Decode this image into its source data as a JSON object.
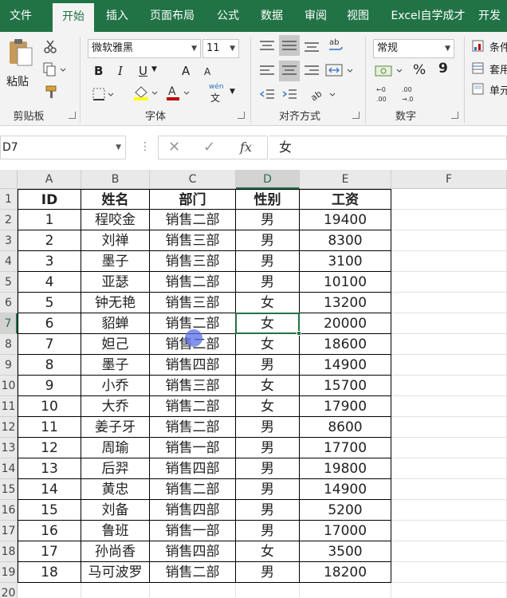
{
  "tabs": [
    "文件",
    "开始",
    "插入",
    "页面布局",
    "公式",
    "数据",
    "审阅",
    "视图",
    "Excel自学成才",
    "开发"
  ],
  "active_tab": 1,
  "ribbon": {
    "clipboard": {
      "label": "剪贴板",
      "paste": "粘贴"
    },
    "font": {
      "label": "字体",
      "name": "微软雅黑",
      "size": "11",
      "bold": "B",
      "italic": "I",
      "underline": "U",
      "grow": "A",
      "shrink": "A",
      "phonetic_top": "wén",
      "phonetic_bottom": "文"
    },
    "alignment": {
      "label": "对齐方式"
    },
    "number": {
      "label": "数字",
      "format": "常规",
      "percent": "%",
      "comma": "9"
    },
    "styles": {
      "item1": "条件",
      "item2": "套用",
      "item3": "单元"
    }
  },
  "formula_bar": {
    "name_box": "D7",
    "fx": "fx",
    "value": "女"
  },
  "columns": [
    "A",
    "B",
    "C",
    "D",
    "E",
    "F"
  ],
  "selected_column": "D",
  "selected_row": 7,
  "rows": [
    "1",
    "2",
    "3",
    "4",
    "5",
    "6",
    "7",
    "8",
    "9",
    "10",
    "11",
    "12",
    "13",
    "14",
    "15",
    "16",
    "17",
    "18",
    "19",
    "20"
  ],
  "table": {
    "headers": [
      "ID",
      "姓名",
      "部门",
      "性别",
      "工资"
    ],
    "rows": [
      [
        "1",
        "程咬金",
        "销售二部",
        "男",
        "19400"
      ],
      [
        "2",
        "刘禅",
        "销售三部",
        "男",
        "8300"
      ],
      [
        "3",
        "墨子",
        "销售三部",
        "男",
        "3100"
      ],
      [
        "4",
        "亚瑟",
        "销售二部",
        "男",
        "10100"
      ],
      [
        "5",
        "钟无艳",
        "销售三部",
        "女",
        "13200"
      ],
      [
        "6",
        "貂蝉",
        "销售二部",
        "女",
        "20000"
      ],
      [
        "7",
        "妲己",
        "销售二部",
        "女",
        "18600"
      ],
      [
        "8",
        "墨子",
        "销售四部",
        "男",
        "14900"
      ],
      [
        "9",
        "小乔",
        "销售三部",
        "女",
        "15700"
      ],
      [
        "10",
        "大乔",
        "销售二部",
        "女",
        "17900"
      ],
      [
        "11",
        "姜子牙",
        "销售二部",
        "男",
        "8600"
      ],
      [
        "12",
        "周瑜",
        "销售一部",
        "男",
        "17700"
      ],
      [
        "13",
        "后羿",
        "销售四部",
        "男",
        "19800"
      ],
      [
        "14",
        "黄忠",
        "销售二部",
        "男",
        "14900"
      ],
      [
        "15",
        "刘备",
        "销售四部",
        "男",
        "5200"
      ],
      [
        "16",
        "鲁班",
        "销售一部",
        "男",
        "17000"
      ],
      [
        "17",
        "孙尚香",
        "销售四部",
        "女",
        "3500"
      ],
      [
        "18",
        "马可波罗",
        "销售二部",
        "男",
        "18200"
      ]
    ]
  },
  "colors": {
    "accent": "#217346",
    "cursor": "#5a6ee6"
  }
}
